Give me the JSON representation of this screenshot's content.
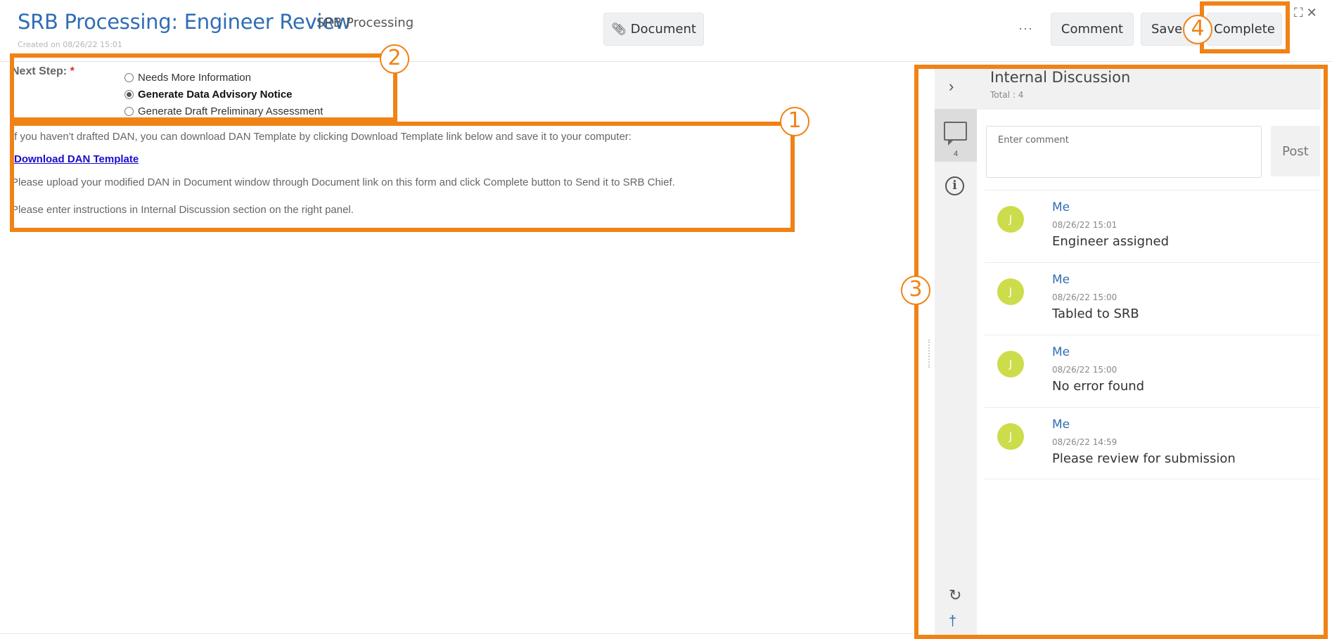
{
  "header": {
    "title": "SRB Processing: Engineer Review",
    "subtitle": "SRB Processing",
    "created": "Created on 08/26/22 15:01",
    "document_label": "Document",
    "more_label": "···",
    "comment_label": "Comment",
    "save_label": "Save",
    "complete_label": "Complete",
    "corner_icons": "↗ ×"
  },
  "form": {
    "next_step_label": "Next Step:",
    "required_mark": "*",
    "options": [
      {
        "label": "Needs More Information",
        "selected": false
      },
      {
        "label": "Generate Data Advisory Notice",
        "selected": true
      },
      {
        "label": "Generate Draft Preliminary Assessment",
        "selected": false
      }
    ],
    "instruction_1": "If you haven't drafted DAN, you can download DAN Template by clicking Download Template link below and save it to your computer:",
    "download_link": "Download DAN Template",
    "instruction_2": "Please upload your modified DAN in Document window through Document link on this form and click Complete button to Send it to SRB Chief.",
    "instruction_3": "Please enter instructions in Internal Discussion section on the right panel."
  },
  "annotations": {
    "n1": "1",
    "n2": "2",
    "n3": "3",
    "n4": "4",
    "color": "#f08216"
  },
  "panel": {
    "title": "Internal Discussion",
    "total": "Total : 4",
    "chat_count": "4",
    "comment_placeholder": "Enter comment",
    "post_label": "Post",
    "comments": [
      {
        "initial": "J",
        "author": "Me",
        "time": "08/26/22 15:01",
        "text": "Engineer assigned"
      },
      {
        "initial": "J",
        "author": "Me",
        "time": "08/26/22 15:00",
        "text": "Tabled to SRB"
      },
      {
        "initial": "J",
        "author": "Me",
        "time": "08/26/22 15:00",
        "text": "No error found"
      },
      {
        "initial": "J",
        "author": "Me",
        "time": "08/26/22 14:59",
        "text": "Please review for submission"
      }
    ]
  }
}
